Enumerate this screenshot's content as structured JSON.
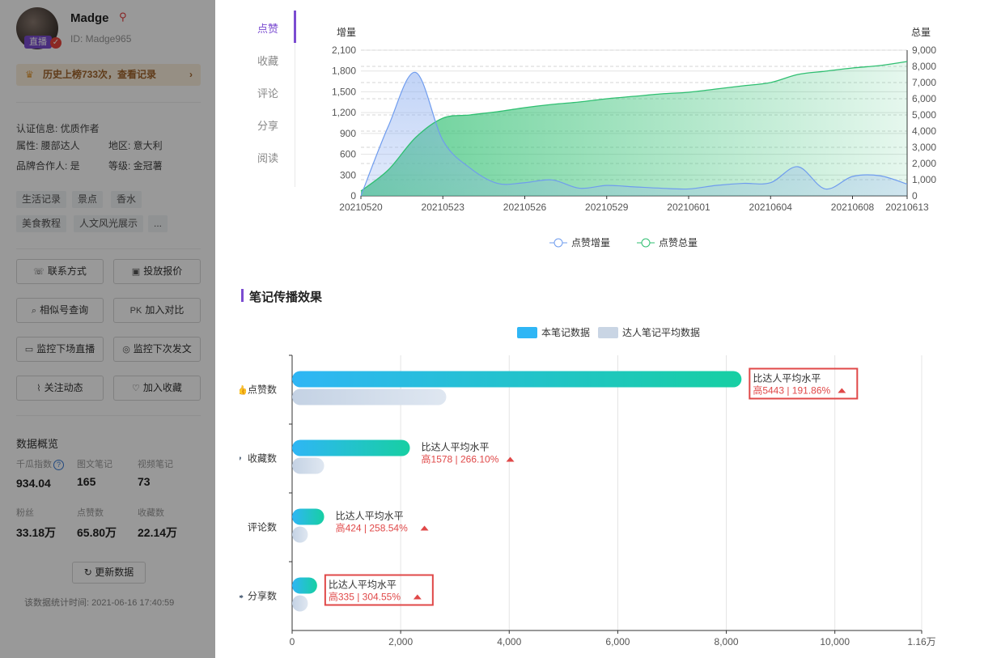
{
  "profile": {
    "name": "Madge",
    "id_text": "ID:  Madge965",
    "live_badge": "直播",
    "rank_text": "历史上榜733次，查看记录",
    "cert": "认证信息:  优质作者",
    "attr": "属性:  腰部达人",
    "region": "地区:  意大利",
    "brand": "品牌合作人:  是",
    "level": "等级:  金冠薯",
    "tags": [
      "生活记录",
      "景点",
      "香水",
      "美食教程",
      "人文风光展示",
      "..."
    ]
  },
  "actions": {
    "contact": "联系方式",
    "quote": "投放报价",
    "similar": "相似号查询",
    "compare_prefix": "PK",
    "compare": "加入对比",
    "monitor_live": "监控下场直播",
    "monitor_post": "监控下次发文",
    "follow": "关注动态",
    "favorite": "加入收藏"
  },
  "overview": {
    "title": "数据概览",
    "stats": [
      {
        "label": "千瓜指数",
        "value": "934.04"
      },
      {
        "label": "图文笔记",
        "value": "165"
      },
      {
        "label": "视频笔记",
        "value": "73"
      },
      {
        "label": "粉丝",
        "value": "33.18万"
      },
      {
        "label": "点赞数",
        "value": "65.80万"
      },
      {
        "label": "收藏数",
        "value": "22.14万"
      }
    ],
    "refresh": "更新数据",
    "update_time": "该数据统计时间: 2021-06-16 17:40:59"
  },
  "tabs": [
    "点赞",
    "收藏",
    "评论",
    "分享",
    "阅读"
  ],
  "section_title": "笔记传播效果",
  "colors": {
    "accent": "#7b4cd1",
    "blue_series": "#6f9cee",
    "green_series": "#2fbf71",
    "highlight_red": "#e04848"
  },
  "chart_data": [
    {
      "type": "line",
      "title": "",
      "ylabel_left": "增量",
      "ylabel_right": "总量",
      "x_tick_labels": [
        "20210520",
        "20210523",
        "20210526",
        "20210529",
        "20210601",
        "20210604",
        "20210608",
        "20210613"
      ],
      "y_left_ticks": [
        "0",
        "300",
        "600",
        "900",
        "1,200",
        "1,500",
        "1,800",
        "2,100"
      ],
      "y_right_ticks": [
        "0",
        "1,000",
        "2,000",
        "3,000",
        "4,000",
        "5,000",
        "6,000",
        "7,000",
        "8,000",
        "9,000"
      ],
      "ylim_left": [
        0,
        2100
      ],
      "ylim_right": [
        0,
        9000
      ],
      "x": [
        0,
        1,
        2,
        3,
        4,
        5,
        6,
        7,
        8,
        9,
        10,
        11,
        12,
        13,
        14,
        15,
        16,
        17,
        18,
        19,
        20
      ],
      "series": [
        {
          "name": "点赞增量",
          "axis": "left",
          "area": true,
          "values": [
            0,
            1000,
            1780,
            800,
            400,
            180,
            190,
            230,
            110,
            150,
            130,
            110,
            100,
            150,
            180,
            190,
            420,
            100,
            280,
            290,
            170
          ]
        },
        {
          "name": "点赞总量",
          "axis": "right",
          "area": true,
          "values": [
            300,
            1600,
            3600,
            4800,
            5000,
            5200,
            5450,
            5650,
            5800,
            6000,
            6150,
            6300,
            6400,
            6600,
            6800,
            7000,
            7500,
            7700,
            7900,
            8050,
            8300
          ]
        }
      ],
      "legend": "bottom",
      "grid": true
    },
    {
      "type": "bar",
      "orientation": "horizontal",
      "categories": [
        "点赞数",
        "收藏数",
        "评论数",
        "分享数"
      ],
      "series": [
        {
          "name": "本笔记数据",
          "values": [
            8280,
            2170,
            590,
            460
          ]
        },
        {
          "name": "达人笔记平均数据",
          "values": [
            2840,
            590,
            290,
            290
          ]
        }
      ],
      "xlim": [
        0,
        11600
      ],
      "x_tick_labels": [
        "0",
        "2,000",
        "4,000",
        "6,000",
        "8,000",
        "10,000",
        "1.16万"
      ],
      "legend": "top",
      "grid": true,
      "annotations": [
        {
          "title": "比达人平均水平",
          "detail": "高5443 | 191.86%",
          "highlighted": true
        },
        {
          "title": "比达人平均水平",
          "detail": "高1578 | 266.10%",
          "highlighted": false
        },
        {
          "title": "比达人平均水平",
          "detail": "高424 | 258.54%",
          "highlighted": false
        },
        {
          "title": "比达人平均水平",
          "detail": "高335 | 304.55%",
          "highlighted": true
        }
      ]
    }
  ]
}
